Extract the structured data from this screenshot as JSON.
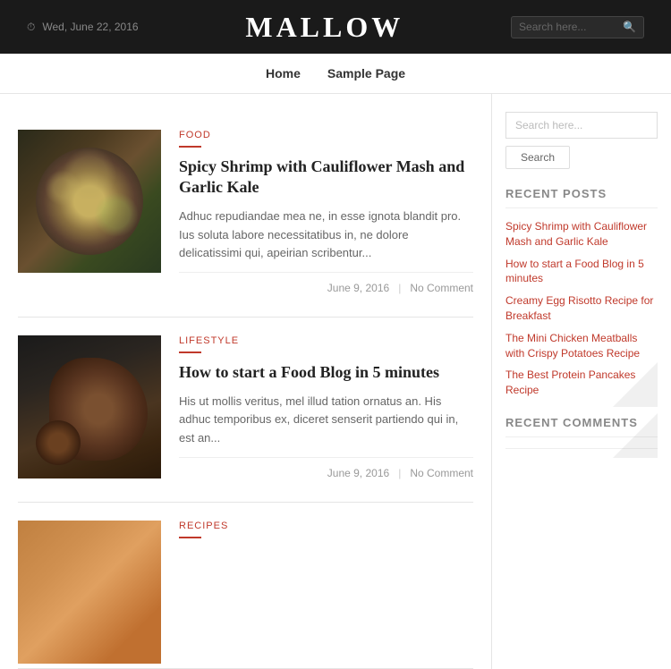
{
  "header": {
    "date": "Wed, June 22, 2016",
    "site_title": "MALLOW",
    "search_placeholder": "Search here..."
  },
  "nav": {
    "items": [
      {
        "label": "Home",
        "href": "#"
      },
      {
        "label": "Sample Page",
        "href": "#"
      }
    ]
  },
  "posts": [
    {
      "category": "FOOD",
      "title": "Spicy Shrimp with Cauliflower Mash and Garlic Kale",
      "excerpt": "Adhuc repudiandae mea ne, in esse ignota blandit pro. Ius soluta labore necessitatibus in, ne dolore delicatissimi qui, apeirian scribentur...",
      "date": "June 9, 2016",
      "comment": "No Comment",
      "thumb_type": "food"
    },
    {
      "category": "LIFESTYLE",
      "title": "How to start a Food Blog in 5 minutes",
      "excerpt": "His ut mollis veritus, mel illud tation ornatus an. His adhuc temporibus ex, diceret senserit partiendo qui in, est an...",
      "date": "June 9, 2016",
      "comment": "No Comment",
      "thumb_type": "blog"
    },
    {
      "category": "RECIPES",
      "title": "",
      "excerpt": "",
      "date": "",
      "comment": "",
      "thumb_type": "recipes"
    }
  ],
  "sidebar": {
    "search_placeholder": "Search here...",
    "search_button": "Search",
    "recent_posts_title": "Recent Posts",
    "recent_posts": [
      "Spicy Shrimp with Cauliflower Mash and Garlic Kale",
      "How to start a Food Blog in 5 minutes",
      "Creamy Egg Risotto Recipe for Breakfast",
      "The Mini Chicken Meatballs with Crispy Potatoes Recipe",
      "The Best Protein Pancakes Recipe"
    ],
    "recent_comments_title": "Recent Comments"
  }
}
